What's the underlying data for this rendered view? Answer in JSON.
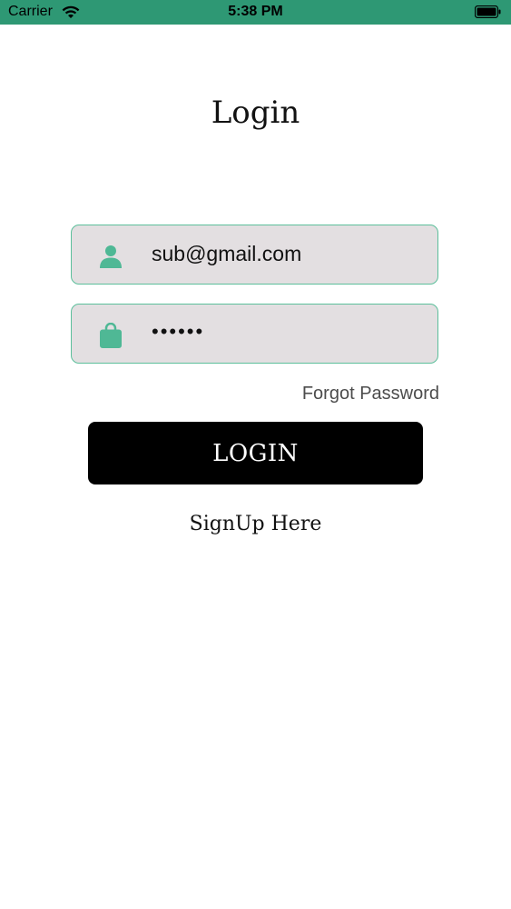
{
  "status_bar": {
    "carrier": "Carrier",
    "time": "5:38 PM",
    "color": "#2e9874"
  },
  "screen": {
    "title": "Login"
  },
  "form": {
    "email": {
      "value": "sub@gmail.com",
      "icon": "person-icon"
    },
    "password": {
      "value": "••••••",
      "icon": "bag-icon"
    },
    "forgot_label": "Forgot Password",
    "login_label": "LOGIN",
    "signup_label": "SignUp Here"
  },
  "colors": {
    "accent": "#4fb895",
    "field_background": "#e3dfe1",
    "button_background": "#000000"
  }
}
